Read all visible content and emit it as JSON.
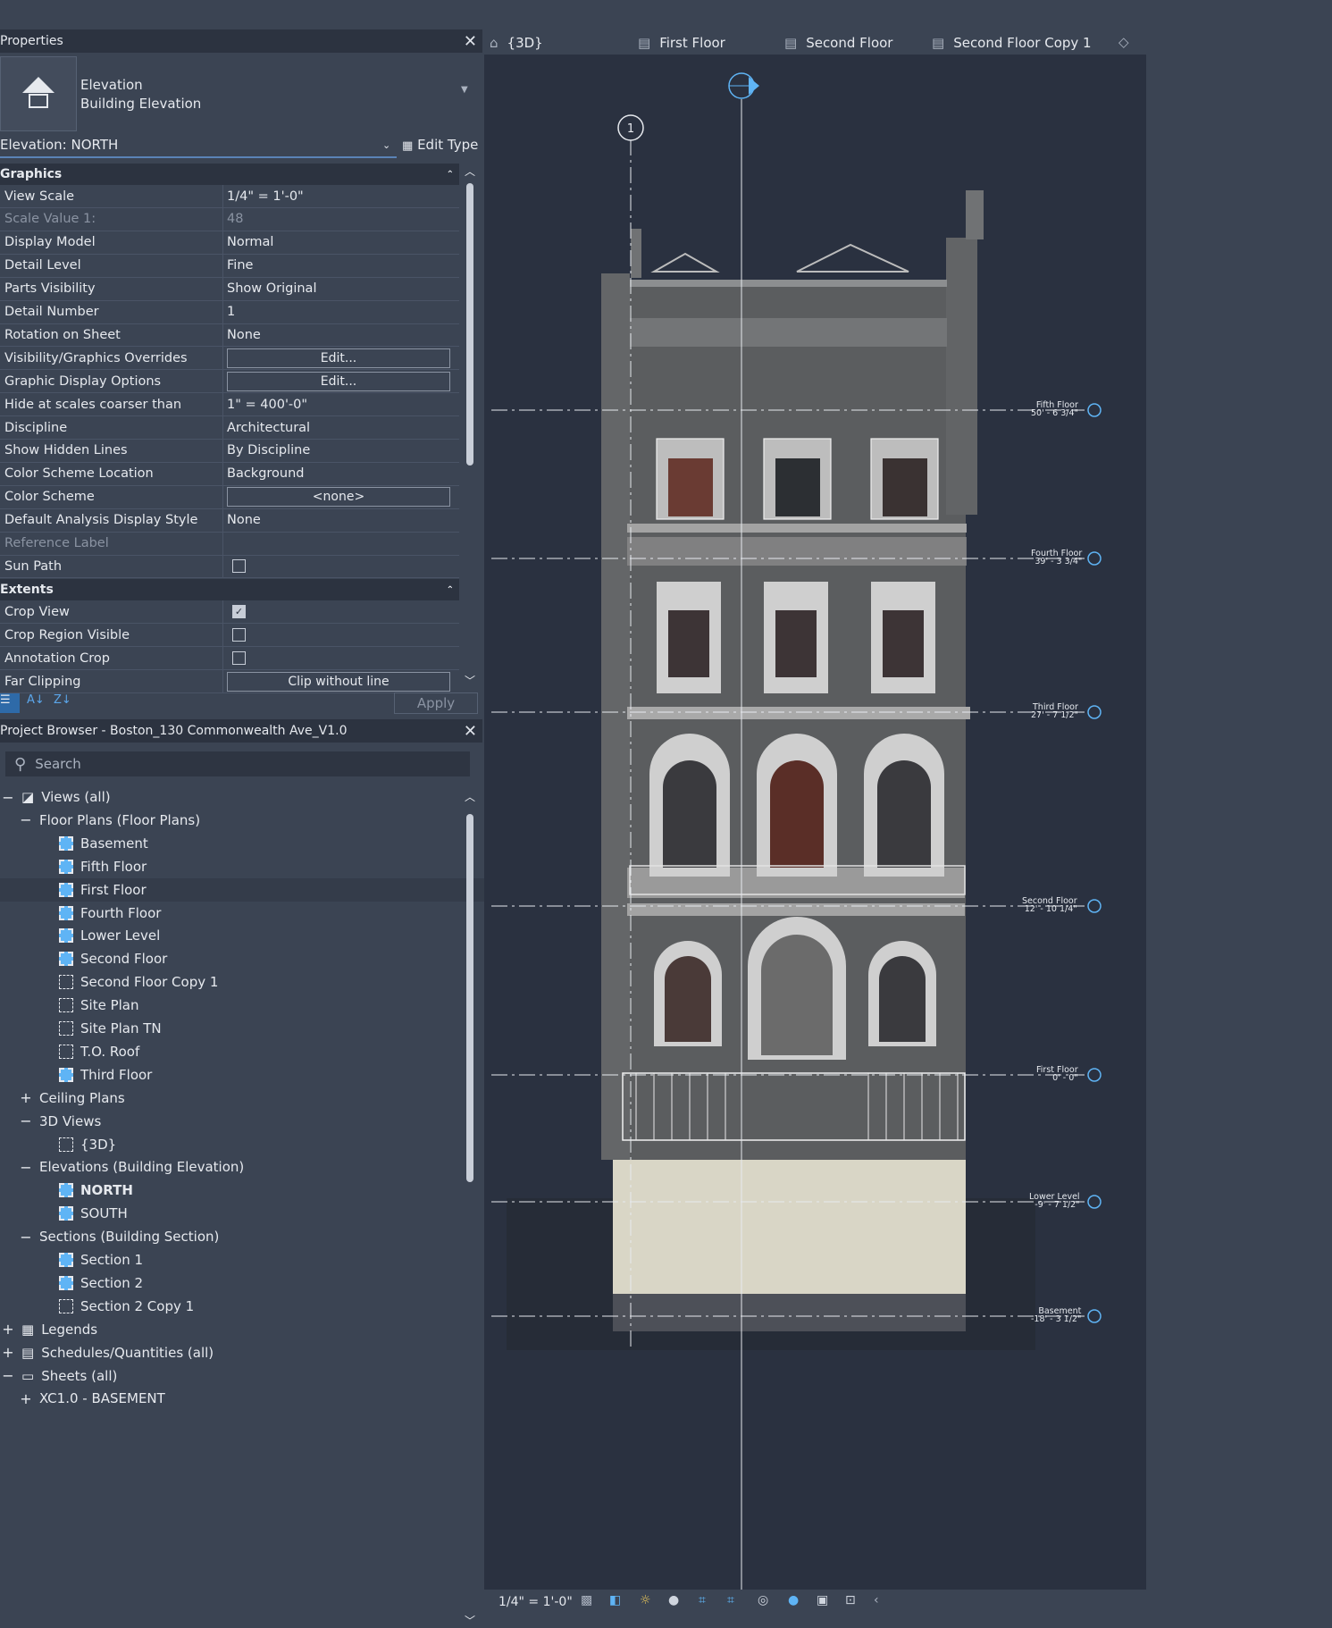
{
  "properties": {
    "title": "Properties",
    "type_name": "Elevation",
    "type_sub": "Building Elevation",
    "instance": "Elevation: NORTH",
    "edit_type": "Edit Type",
    "groups": {
      "graphics": "Graphics",
      "extents": "Extents"
    },
    "rows": [
      {
        "k": "View Scale",
        "v": "1/4\" = 1'-0\""
      },
      {
        "k": "Scale Value    1:",
        "v": "48"
      },
      {
        "k": "Display Model",
        "v": "Normal"
      },
      {
        "k": "Detail Level",
        "v": "Fine"
      },
      {
        "k": "Parts Visibility",
        "v": "Show Original"
      },
      {
        "k": "Detail Number",
        "v": "1"
      },
      {
        "k": "Rotation on Sheet",
        "v": "None"
      },
      {
        "k": "Visibility/Graphics Overrides",
        "v": "Edit..."
      },
      {
        "k": "Graphic Display Options",
        "v": "Edit..."
      },
      {
        "k": "Hide at scales coarser than",
        "v": "1\" = 400'-0\""
      },
      {
        "k": "Discipline",
        "v": "Architectural"
      },
      {
        "k": "Show Hidden Lines",
        "v": "By Discipline"
      },
      {
        "k": "Color Scheme Location",
        "v": "Background"
      },
      {
        "k": "Color Scheme",
        "v": "<none>"
      },
      {
        "k": "Default Analysis Display Style",
        "v": "None"
      },
      {
        "k": "Reference Label",
        "v": ""
      },
      {
        "k": "Sun Path",
        "v": ""
      }
    ],
    "extents_rows": [
      {
        "k": "Crop View",
        "v": ""
      },
      {
        "k": "Crop Region Visible",
        "v": ""
      },
      {
        "k": "Annotation Crop",
        "v": ""
      },
      {
        "k": "Far Clipping",
        "v": "Clip without line"
      }
    ],
    "apply": "Apply"
  },
  "browser": {
    "title": "Project Browser - Boston_130 Commonwealth Ave_V1.0",
    "search_placeholder": "Search",
    "items": [
      {
        "label": "Views (all)"
      },
      {
        "label": "Floor Plans (Floor Plans)"
      },
      {
        "label": "Basement"
      },
      {
        "label": "Fifth Floor"
      },
      {
        "label": "First Floor"
      },
      {
        "label": "Fourth Floor"
      },
      {
        "label": "Lower Level"
      },
      {
        "label": "Second Floor"
      },
      {
        "label": "Second Floor Copy 1"
      },
      {
        "label": "Site Plan"
      },
      {
        "label": "Site Plan TN"
      },
      {
        "label": "T.O. Roof"
      },
      {
        "label": "Third Floor"
      },
      {
        "label": "Ceiling Plans"
      },
      {
        "label": "3D Views"
      },
      {
        "label": "{3D}"
      },
      {
        "label": "Elevations (Building Elevation)"
      },
      {
        "label": "NORTH"
      },
      {
        "label": "SOUTH"
      },
      {
        "label": "Sections (Building Section)"
      },
      {
        "label": "Section 1"
      },
      {
        "label": "Section 2"
      },
      {
        "label": "Section 2 Copy 1"
      },
      {
        "label": "Legends"
      },
      {
        "label": "Schedules/Quantities (all)"
      },
      {
        "label": "Sheets (all)"
      },
      {
        "label": "XC1.0 - BASEMENT"
      }
    ]
  },
  "tabs": [
    {
      "label": "{3D}"
    },
    {
      "label": "First Floor"
    },
    {
      "label": "Second Floor"
    },
    {
      "label": "Second Floor Copy 1"
    }
  ],
  "grid_label": "1",
  "levels": [
    {
      "name": "Fifth Floor",
      "elev": "50' - 6 3/4\""
    },
    {
      "name": "Fourth Floor",
      "elev": "39' - 3 3/4\""
    },
    {
      "name": "Third Floor",
      "elev": "27' - 7 1/2\""
    },
    {
      "name": "Second Floor",
      "elev": "12' - 10 1/4\""
    },
    {
      "name": "First Floor",
      "elev": "0' - 0\""
    },
    {
      "name": "Lower Level",
      "elev": "-9' - 7 1/2\""
    },
    {
      "name": "Basement",
      "elev": "-18' - 3 1/2\""
    }
  ],
  "status": {
    "scale": "1/4\" = 1'-0\""
  },
  "colors": {
    "accent": "#5fb4f5",
    "panel": "#3b4453",
    "header": "#2c3340",
    "canvas": "#2a3140"
  }
}
